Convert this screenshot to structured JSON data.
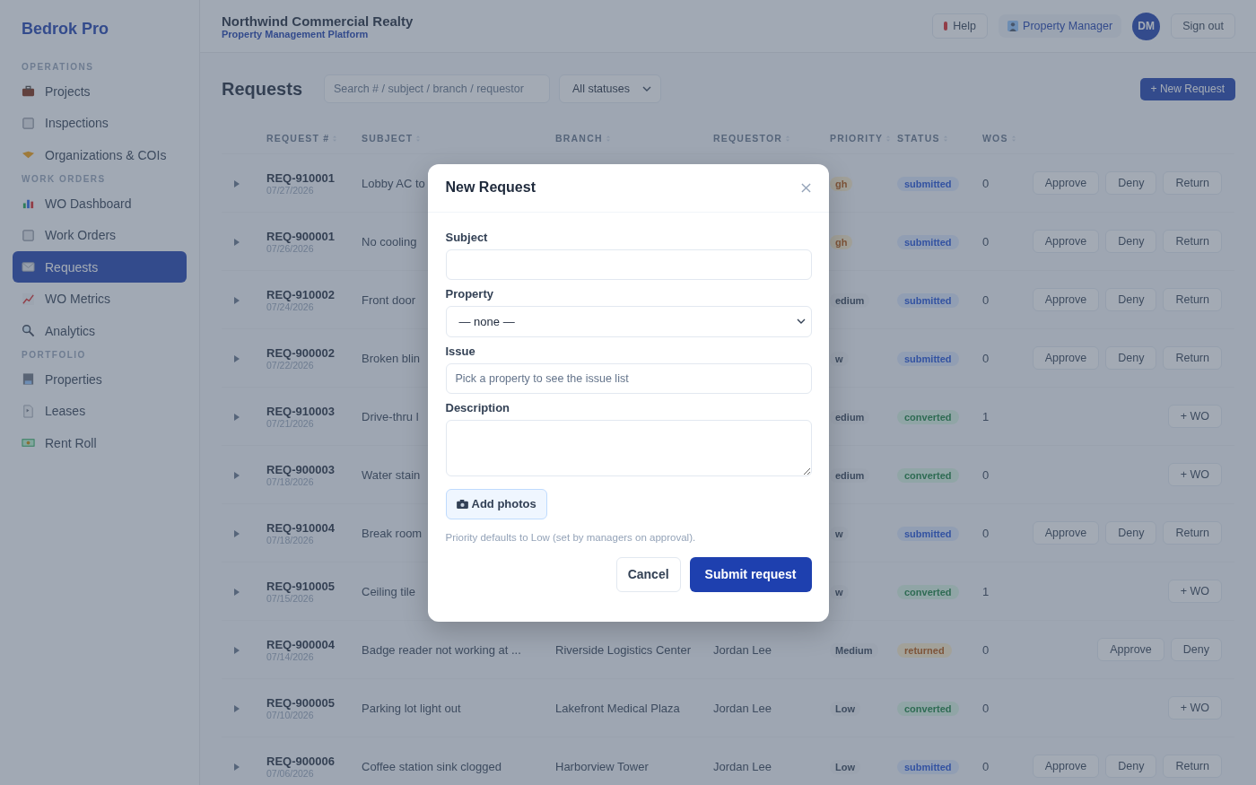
{
  "sidebar": {
    "brand": "Bedrok Pro",
    "sections": [
      {
        "title": "OPERATIONS",
        "items": [
          {
            "label": "Projects",
            "selected": false
          },
          {
            "label": "Inspections",
            "selected": false
          },
          {
            "label": "Organizations & COIs",
            "selected": false
          }
        ]
      },
      {
        "title": "WORK ORDERS",
        "items": [
          {
            "label": "WO Dashboard",
            "selected": false
          },
          {
            "label": "Work Orders",
            "selected": false
          },
          {
            "label": "Requests",
            "selected": true
          },
          {
            "label": "WO Metrics",
            "selected": false
          },
          {
            "label": "Analytics",
            "selected": false
          }
        ]
      },
      {
        "title": "PORTFOLIO",
        "items": [
          {
            "label": "Properties",
            "selected": false
          },
          {
            "label": "Leases",
            "selected": false
          },
          {
            "label": "Rent Roll",
            "selected": false
          }
        ]
      }
    ]
  },
  "header": {
    "title": "Northwind Commercial Realty",
    "subtitle": "Property Management Platform",
    "help": "Help",
    "role": "Property Manager",
    "avatar": "DM",
    "sign_out": "Sign out"
  },
  "toolbar": {
    "title": "Requests",
    "search": {
      "placeholder": "Search # / subject / branch / requestor"
    },
    "status_filter": "All statuses",
    "new_button": "+ New Request"
  },
  "table": {
    "columns": [
      "REQUEST #",
      "SUBJECT",
      "BRANCH",
      "REQUESTOR",
      "PRIORITY",
      "STATUS",
      "WOS"
    ],
    "rows": [
      {
        "id": "REQ-910001",
        "date": "07/27/2026",
        "subject": "Lobby AC to",
        "priority": {
          "text": "gh",
          "kind": "high"
        },
        "status": {
          "text": "submitted",
          "kind": "submitted"
        },
        "wos": "0",
        "actions": [
          "Approve",
          "Deny",
          "Return"
        ]
      },
      {
        "id": "REQ-900001",
        "date": "07/26/2026",
        "subject": "No cooling",
        "priority": {
          "text": "gh",
          "kind": "high"
        },
        "status": {
          "text": "submitted",
          "kind": "submitted"
        },
        "wos": "0",
        "actions": [
          "Approve",
          "Deny",
          "Return"
        ]
      },
      {
        "id": "REQ-910002",
        "date": "07/24/2026",
        "subject": "Front door",
        "priority": {
          "text": "edium",
          "kind": "medium"
        },
        "status": {
          "text": "submitted",
          "kind": "submitted"
        },
        "wos": "0",
        "actions": [
          "Approve",
          "Deny",
          "Return"
        ]
      },
      {
        "id": "REQ-900002",
        "date": "07/22/2026",
        "subject": "Broken blin",
        "priority": {
          "text": "w",
          "kind": "low"
        },
        "status": {
          "text": "submitted",
          "kind": "submitted"
        },
        "wos": "0",
        "actions": [
          "Approve",
          "Deny",
          "Return"
        ]
      },
      {
        "id": "REQ-910003",
        "date": "07/21/2026",
        "subject": "Drive-thru l",
        "priority": {
          "text": "edium",
          "kind": "medium"
        },
        "status": {
          "text": "converted",
          "kind": "converted"
        },
        "wos": "1",
        "actions": [
          "+ WO"
        ]
      },
      {
        "id": "REQ-900003",
        "date": "07/18/2026",
        "subject": "Water stain",
        "priority": {
          "text": "edium",
          "kind": "medium"
        },
        "status": {
          "text": "converted",
          "kind": "converted"
        },
        "wos": "0",
        "actions": [
          "+ WO"
        ]
      },
      {
        "id": "REQ-910004",
        "date": "07/18/2026",
        "subject": "Break room",
        "priority": {
          "text": "w",
          "kind": "low"
        },
        "status": {
          "text": "submitted",
          "kind": "submitted"
        },
        "wos": "0",
        "actions": [
          "Approve",
          "Deny",
          "Return"
        ]
      },
      {
        "id": "REQ-910005",
        "date": "07/15/2026",
        "subject": "Ceiling tile",
        "priority": {
          "text": "w",
          "kind": "low"
        },
        "status": {
          "text": "converted",
          "kind": "converted"
        },
        "wos": "1",
        "actions": [
          "+ WO"
        ]
      },
      {
        "id": "REQ-900004",
        "date": "07/14/2026",
        "subject": "Badge reader not working at ...",
        "branch": "Riverside Logistics Center",
        "requestor": "Jordan Lee",
        "priority": {
          "text": "Medium",
          "kind": "medium"
        },
        "status": {
          "text": "returned",
          "kind": "returned"
        },
        "wos": "0",
        "actions": [
          "Approve",
          "Deny"
        ]
      },
      {
        "id": "REQ-900005",
        "date": "07/10/2026",
        "subject": "Parking lot light out",
        "branch": "Lakefront Medical Plaza",
        "requestor": "Jordan Lee",
        "priority": {
          "text": "Low",
          "kind": "low"
        },
        "status": {
          "text": "converted",
          "kind": "converted"
        },
        "wos": "0",
        "actions": [
          "+ WO"
        ]
      },
      {
        "id": "REQ-900006",
        "date": "07/06/2026",
        "subject": "Coffee station sink clogged",
        "branch": "Harborview Tower",
        "requestor": "Jordan Lee",
        "priority": {
          "text": "Low",
          "kind": "low"
        },
        "status": {
          "text": "submitted",
          "kind": "submitted"
        },
        "wos": "0",
        "actions": [
          "Approve",
          "Deny",
          "Return"
        ]
      }
    ]
  },
  "modal": {
    "title": "New Request",
    "fields": [
      {
        "kind": "text",
        "label": "Subject"
      },
      {
        "kind": "select",
        "label": "Property",
        "value": "— none —"
      },
      {
        "kind": "text",
        "label": "Issue",
        "placeholder": "Pick a property to see the issue list"
      },
      {
        "kind": "textarea",
        "label": "Description"
      }
    ],
    "add_photos": "Add photos",
    "hint": "Priority defaults to Low (set by managers on approval).",
    "cancel": "Cancel",
    "submit": "Submit request"
  }
}
